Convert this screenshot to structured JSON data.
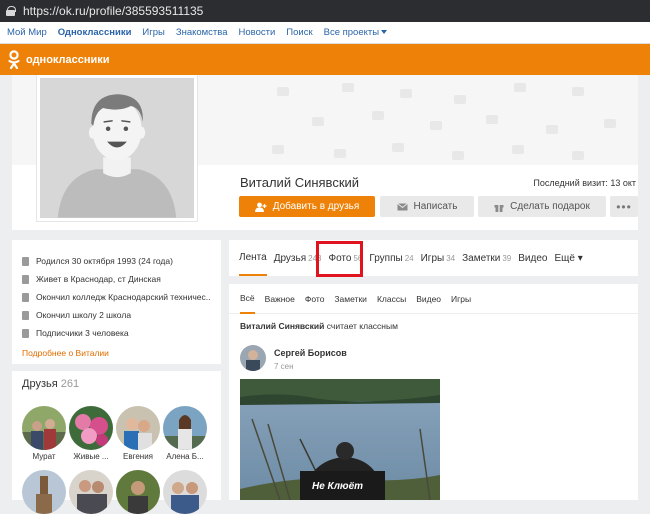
{
  "browser": {
    "url": "https://ok.ru/profile/385593511135"
  },
  "topnav": {
    "items": [
      "Мой Мир",
      "Одноклассники",
      "Игры",
      "Знакомства",
      "Новости",
      "Поиск",
      "Все проекты"
    ]
  },
  "header": {
    "brand": "одноклассники"
  },
  "profile": {
    "name": "Виталий Синявский",
    "last_visit": "Последний визит: 13 окт",
    "add_friend": "Добавить в друзья",
    "write": "Написать",
    "gift": "Сделать подарок",
    "more": "•••"
  },
  "info": {
    "rows": [
      "Родился 30 октября 1993 (24 года)",
      "Живет в Краснодар, ст Динская",
      "Окончил колледж Краснодарский техничес...",
      "Окончил школу 2 школа",
      "Подписчики 3 человека"
    ],
    "more_link": "Подробнее о Виталии"
  },
  "friends": {
    "title": "Друзья",
    "count": "261",
    "names": [
      "Мурат",
      "Живые ...",
      "Евгения",
      "Алена Б..."
    ]
  },
  "tabs": [
    {
      "label": "Лента",
      "count": ""
    },
    {
      "label": "Друзья",
      "count": "243"
    },
    {
      "label": "Фото",
      "count": "56"
    },
    {
      "label": "Группы",
      "count": "24"
    },
    {
      "label": "Игры",
      "count": "34"
    },
    {
      "label": "Заметки",
      "count": "39"
    },
    {
      "label": "Видео",
      "count": ""
    },
    {
      "label": "Ещё ▾",
      "count": ""
    }
  ],
  "feed": {
    "subtabs": [
      "Всё",
      "Важное",
      "Фото",
      "Заметки",
      "Классы",
      "Видео",
      "Игры"
    ],
    "liked_author": "Виталий Синявский",
    "liked_text": " считает классным",
    "post_author": "Сергей Борисов",
    "post_date": "7 сен",
    "photo_caption": "Не Клюёт"
  },
  "colors": {
    "accent": "#ee8208",
    "link": "#2a64a8",
    "highlight": "#e0141e"
  }
}
